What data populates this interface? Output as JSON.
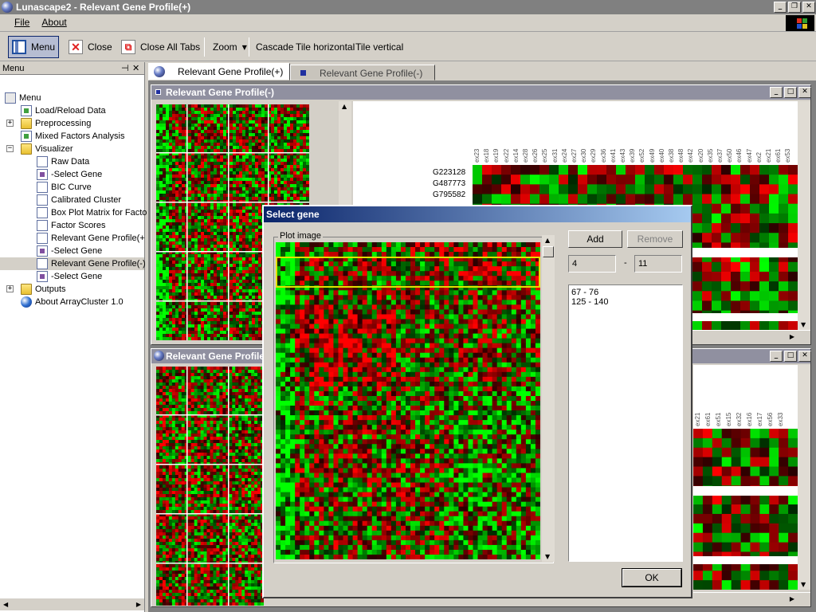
{
  "app": {
    "title": "Lunascape2 - Relevant Gene Profile(+)",
    "colors": {
      "heat_red": "#e01010",
      "heat_green": "#10e010",
      "dialog_title": "#0a246a",
      "highlight": "#e0e000"
    }
  },
  "menubar": {
    "file": "File",
    "about": "About"
  },
  "toolbar": {
    "menu": "Menu",
    "close": "Close",
    "close_all": "Close All Tabs",
    "zoom": "Zoom",
    "cascade": "Cascade",
    "tile_h": "Tile horizontal",
    "tile_v": "Tile vertical"
  },
  "panel": {
    "title": "Menu",
    "pin": "▢",
    "close": "✕"
  },
  "tree": [
    {
      "label": "Menu",
      "icon": "menu-root-icon"
    },
    {
      "label": "Load/Reload Data",
      "icon": "document-icon"
    },
    {
      "label": "Preprocessing",
      "icon": "folder-icon"
    },
    {
      "label": "Mixed Factors Analysis",
      "icon": "document-icon"
    },
    {
      "label": "Visualizer",
      "icon": "folder-icon"
    },
    {
      "label": "Raw Data",
      "icon": "document-icon"
    },
    {
      "label": "-Select Gene",
      "icon": "document-icon"
    },
    {
      "label": "BIC Curve",
      "icon": "document-icon"
    },
    {
      "label": "Calibrated Cluster",
      "icon": "document-icon"
    },
    {
      "label": "Box Plot Matrix for Facto",
      "icon": "document-icon"
    },
    {
      "label": "Factor Scores",
      "icon": "document-icon"
    },
    {
      "label": "Relevant Gene Profile(+",
      "icon": "document-icon"
    },
    {
      "label": "-Select Gene",
      "icon": "document-icon"
    },
    {
      "label": "Relevant Gene Profile(-)",
      "icon": "document-icon"
    },
    {
      "label": "-Select Gene",
      "icon": "document-icon"
    },
    {
      "label": "Outputs",
      "icon": "folder-icon"
    },
    {
      "label": "About ArrayCluster 1.0",
      "icon": "info-icon"
    }
  ],
  "tabs": [
    {
      "label": "Relevant Gene Profile(+)"
    },
    {
      "label": "Relevant Gene Profile(-)"
    }
  ],
  "windows": {
    "top_title": "Relevant Gene Profile(-)",
    "bottom_title": "Relevant Gene Profile",
    "gene_labels": [
      "G223128",
      "G487773",
      "G795582"
    ],
    "col_labels_top": [
      "ex23",
      "ex18",
      "ex19",
      "ex22",
      "ex14",
      "ex28",
      "ex26",
      "ex25",
      "ex31",
      "ex24",
      "ex27",
      "ex30",
      "ex29",
      "ex36",
      "ex41",
      "ex43",
      "ex39",
      "ex52",
      "ex49",
      "ex40",
      "ex38",
      "ex48",
      "ex42",
      "ex20",
      "ex35",
      "ex37",
      "ex50",
      "ex46",
      "ex47",
      "ex2",
      "ex21",
      "ex61",
      "ex53"
    ],
    "col_labels_bottom": [
      "ex21",
      "ex61",
      "ex51",
      "ex15",
      "ex32",
      "ex16",
      "ex17",
      "ex56",
      "ex33"
    ]
  },
  "dialog": {
    "title": "Select gene",
    "group_label": "Plot image",
    "add": "Add",
    "remove": "Remove",
    "from": "4",
    "dash": "-",
    "to": "11",
    "ranges": [
      "67 - 76",
      "125 - 140"
    ],
    "ok": "OK"
  }
}
